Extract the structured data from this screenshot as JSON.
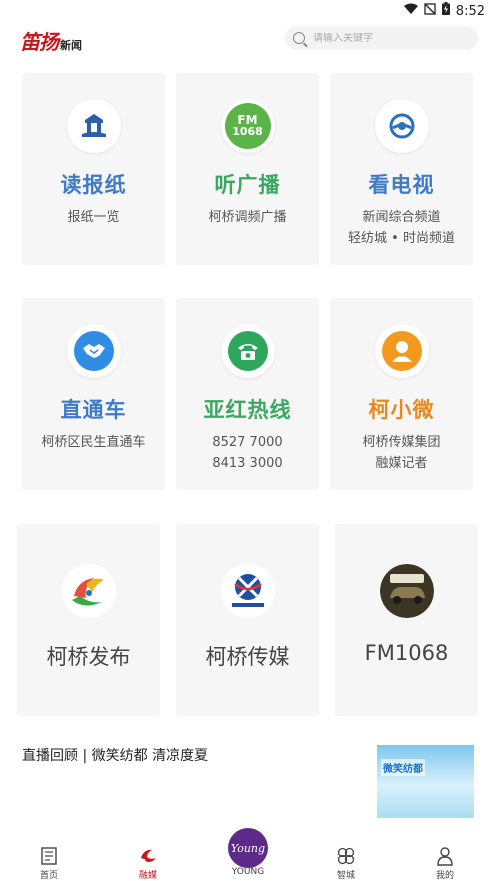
{
  "status": {
    "time": "8:52"
  },
  "header": {
    "logo_main": "笛扬",
    "logo_sub": "新闻",
    "search_placeholder": "请输入关键字"
  },
  "cards_row1": [
    {
      "title": "读报纸",
      "desc": [
        "报纸一览"
      ],
      "icon": "newspaper-building-icon",
      "color": "blue"
    },
    {
      "title": "听广播",
      "desc": [
        "柯桥调频广播"
      ],
      "icon": "fm1068-icon",
      "color": "green"
    },
    {
      "title": "看电视",
      "desc": [
        "新闻综合频道",
        "轻纺城 • 时尚频道"
      ],
      "icon": "tv-station-icon",
      "color": "blue"
    }
  ],
  "cards_row2": [
    {
      "title": "直通车",
      "desc": [
        "柯桥区民生直通车"
      ],
      "icon": "handshake-icon",
      "color": "blue"
    },
    {
      "title": "亚红热线",
      "desc": [
        "8527 7000",
        "8413 3000"
      ],
      "icon": "telephone-icon",
      "color": "green"
    },
    {
      "title": "柯小微",
      "desc": [
        "柯桥传媒集团",
        "融媒记者"
      ],
      "icon": "reporter-avatar-icon",
      "color": "orange"
    }
  ],
  "cards_row3": [
    {
      "title": "柯桥发布",
      "icon": "keqiao-release-logo-icon"
    },
    {
      "title": "柯桥传媒",
      "icon": "keqiao-media-logo-icon"
    },
    {
      "title": "FM1068",
      "icon": "fm1068-car-logo-icon"
    }
  ],
  "fm_icon_text": {
    "line1": "FM",
    "line2": "1068"
  },
  "banner": {
    "text": "直播回顾 | 微笑纺都 清凉度夏",
    "image_text": "微笑纺都"
  },
  "tabbar": [
    {
      "label": "首页",
      "icon": "home-news-icon"
    },
    {
      "label": "融媒",
      "icon": "rongmei-icon",
      "active": true
    },
    {
      "label": "YOUNG",
      "icon": "young-logo-icon"
    },
    {
      "label": "智城",
      "icon": "smart-city-icon"
    },
    {
      "label": "我的",
      "icon": "user-icon"
    }
  ],
  "young_logo_text": "Young",
  "colors": {
    "blue": "#3f7ac8",
    "green": "#3aa860",
    "orange": "#e8891d",
    "brand_red": "#c8161d"
  }
}
